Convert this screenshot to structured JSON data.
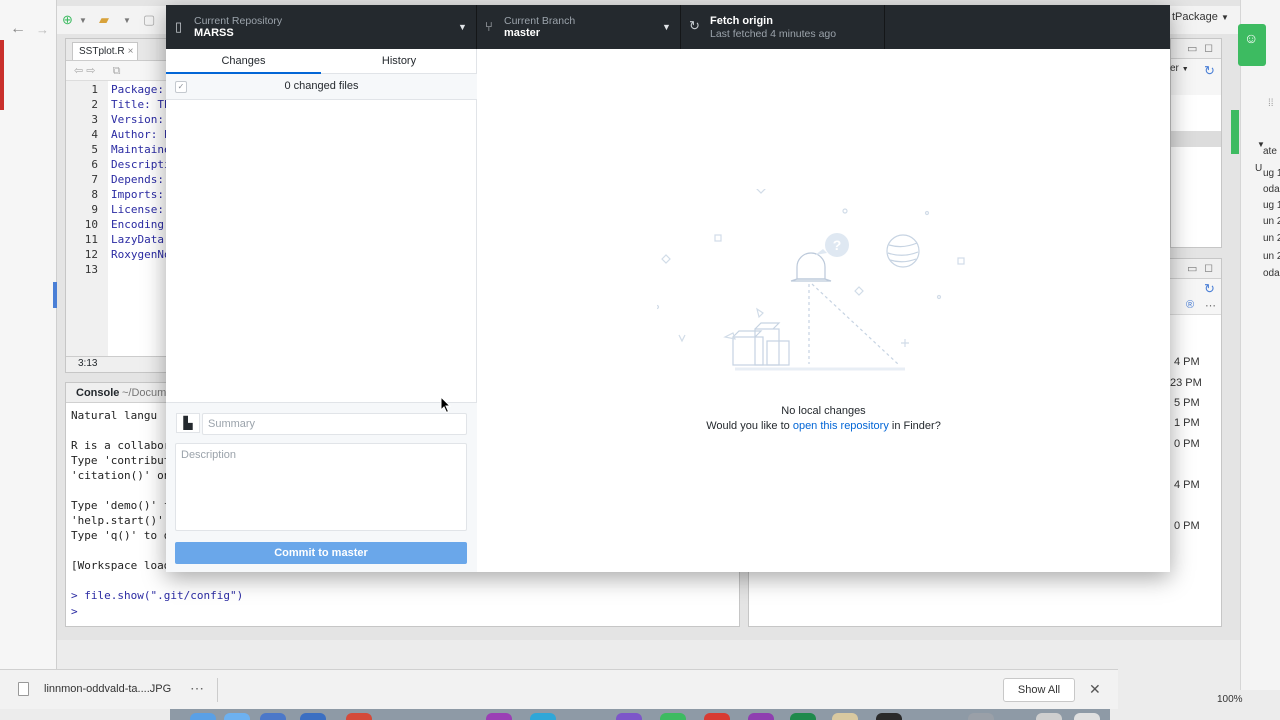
{
  "rstudio": {
    "project_label": "tPackage",
    "source": {
      "tab_label": "SSTplot.R",
      "status_position": "3:13",
      "line_numbers": [
        "1",
        "2",
        "3",
        "4",
        "5",
        "6",
        "7",
        "8",
        "9",
        "10",
        "11",
        "12",
        "13"
      ],
      "lines": [
        "Package:",
        "Title: Th",
        "Version:",
        "Author: E",
        "Maintaine",
        "Descripti",
        "Depends:",
        "Imports:",
        "License:",
        "Encoding:",
        "LazyData:",
        "RoxygenNo",
        ""
      ]
    },
    "console": {
      "title": "Console",
      "path": "~/Docum",
      "lines": [
        "  Natural langu",
        "",
        "R is a collabor",
        "Type 'contribut",
        "'citation()' on",
        "",
        "Type 'demo()' f",
        "'help.start()'",
        "Type 'q()' to q",
        "",
        "[Workspace load",
        "",
        "> file.show(\".git/config\")",
        "> "
      ]
    },
    "env_dropdown": "er",
    "file_times": [
      "4 PM",
      "23 PM",
      "5 PM",
      "1 PM",
      "0 PM",
      "4 PM",
      "0 PM"
    ],
    "right_strip_text": [
      "ate",
      "U",
      "ug 1",
      "oda",
      "ug 1",
      "un 2",
      "un 2",
      "un 2",
      "oda",
      "100%"
    ]
  },
  "github": {
    "toolbar": {
      "repo_label": "Current Repository",
      "repo_name": "MARSS",
      "branch_label": "Current Branch",
      "branch_name": "master",
      "fetch_title": "Fetch origin",
      "fetch_sub": "Last fetched 4 minutes ago"
    },
    "tabs": {
      "changes": "Changes",
      "history": "History"
    },
    "changed_files": "0 changed files",
    "commit": {
      "summary_placeholder": "Summary",
      "description_placeholder": "Description",
      "button_label": "Commit to master"
    },
    "empty_state": {
      "title": "No local changes",
      "prefix": "Would you like to",
      "link": "open this repository",
      "suffix": "in Finder?"
    }
  },
  "downloads": {
    "filename": "linnmon-oddvald-ta....JPG",
    "show_all": "Show All"
  },
  "colors": {
    "toolbar_bg": "#24292e",
    "accent": "#0366d6",
    "commit_button": "#6aa7ea"
  }
}
